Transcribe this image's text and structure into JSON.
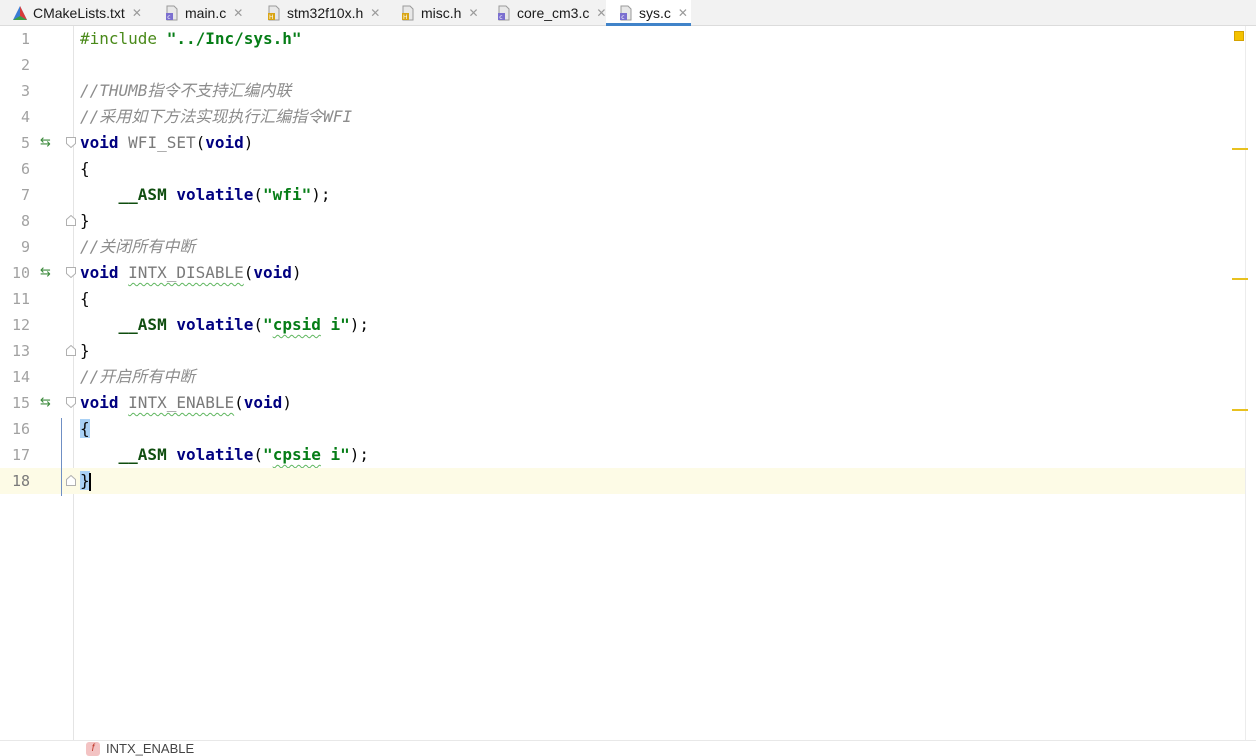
{
  "tabs": [
    {
      "label": "CMakeLists.txt",
      "icon": "cmake-icon",
      "active": false
    },
    {
      "label": "main.c",
      "icon": "c-file-icon",
      "active": false
    },
    {
      "label": "stm32f10x.h",
      "icon": "h-file-icon",
      "active": false
    },
    {
      "label": "misc.h",
      "icon": "h-file-icon",
      "active": false
    },
    {
      "label": "core_cm3.c",
      "icon": "c-file-icon",
      "active": false
    },
    {
      "label": "sys.c",
      "icon": "c-file-icon",
      "active": true
    }
  ],
  "tab_close_glyph": "✕",
  "line_numbers": [
    "1",
    "2",
    "3",
    "4",
    "5",
    "6",
    "7",
    "8",
    "9",
    "10",
    "11",
    "12",
    "13",
    "14",
    "15",
    "16",
    "17",
    "18"
  ],
  "current_line": "18",
  "code": {
    "l1_directive": "#include",
    "l1_path": "\"../Inc/sys.h\"",
    "l3_comment": "//THUMB指令不支持汇编内联",
    "l4_comment": "//采用如下方法实现执行汇编指令WFI",
    "l5_kw": "void",
    "l5_name": "WFI_SET",
    "l5_param": "void",
    "open_brace": "{",
    "close_brace": "}",
    "asm_kw": "__ASM",
    "volatile_kw": "volatile",
    "l7_arg": "\"wfi\"",
    "l9_comment": "//关闭所有中断",
    "l10_name": "INTX_DISABLE",
    "l12_arg_open": "\"",
    "l12_arg_word": "cpsid",
    "l12_arg_rest": " i\"",
    "l14_comment": "//开启所有中断",
    "l15_name": "INTX_ENABLE",
    "l17_arg_word": "cpsie"
  },
  "breadcrumb": {
    "icon_letter": "f",
    "label": "INTX_ENABLE"
  },
  "colors": {
    "keyword": "#0033b3",
    "string": "#067d17",
    "comment": "#8c8c8c",
    "active_tab_underline": "#4083c9",
    "current_line_bg": "#fdfbe6",
    "warning_stripe": "#e8c11f"
  }
}
